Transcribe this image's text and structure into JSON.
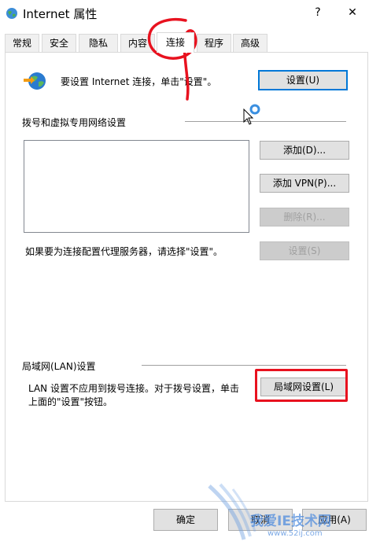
{
  "window": {
    "title": "Internet 属性",
    "help_label": "?",
    "close_label": "✕"
  },
  "tabs": [
    {
      "label": "常规"
    },
    {
      "label": "安全"
    },
    {
      "label": "隐私"
    },
    {
      "label": "内容"
    },
    {
      "label": "连接",
      "active": true
    },
    {
      "label": "程序"
    },
    {
      "label": "高级"
    }
  ],
  "setup": {
    "text": "要设置 Internet 连接，单击\"设置\"。",
    "button": "设置(U)"
  },
  "dialup": {
    "heading": "拨号和虚拟专用网络设置",
    "add_button": "添加(D)...",
    "add_vpn_button": "添加 VPN(P)...",
    "remove_button": "删除(R)...",
    "proxy_text": "如果要为连接配置代理服务器，请选择\"设置\"。",
    "settings_button": "设置(S)"
  },
  "lan": {
    "heading": "局域网(LAN)设置",
    "text_line1": "LAN 设置不应用到拨号连接。对于拨号设置，单击",
    "text_line2": "上面的\"设置\"按钮。",
    "button": "局域网设置(L)"
  },
  "footer": {
    "ok": "确定",
    "cancel": "取消",
    "apply": "应用(A)"
  },
  "watermark": "我爱IE技术网",
  "watermark_url": "www.52ij.com",
  "colors": {
    "accent": "#0078d7",
    "annotation_red": "#e8121f"
  }
}
